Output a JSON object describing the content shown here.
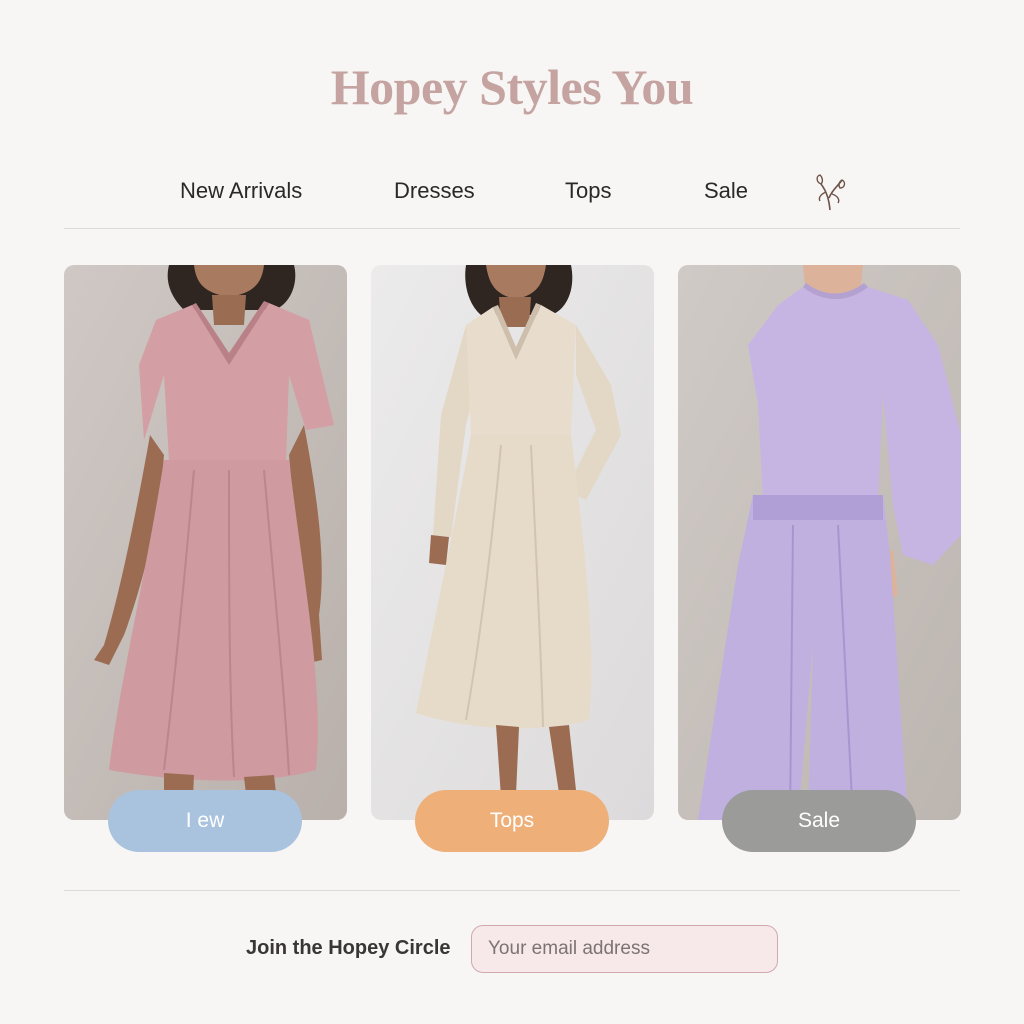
{
  "brand": {
    "title": "Hopey Styles You"
  },
  "nav": {
    "items": [
      {
        "label": "New Arrivals"
      },
      {
        "label": "Dresses"
      },
      {
        "label": "Tops"
      },
      {
        "label": "Sale"
      }
    ],
    "icon": "leaf-sprig-icon"
  },
  "products": [
    {
      "image": "pink-linen-dress",
      "pill_label": "I ew",
      "pill_color": "#a9c3df"
    },
    {
      "image": "beige-linen-dress",
      "pill_label": "Tops",
      "pill_color": "#eeaf78"
    },
    {
      "image": "lavender-sweater-trousers",
      "pill_label": "Sale",
      "pill_color": "#9b9b9a"
    }
  ],
  "signup": {
    "label": "Join the Hopey Circle",
    "placeholder": "Your email address"
  },
  "colors": {
    "brand": "#c4a3a0",
    "background": "#f7f6f5",
    "input_bg": "#f7e9ea",
    "input_border": "#cfa9ad"
  }
}
